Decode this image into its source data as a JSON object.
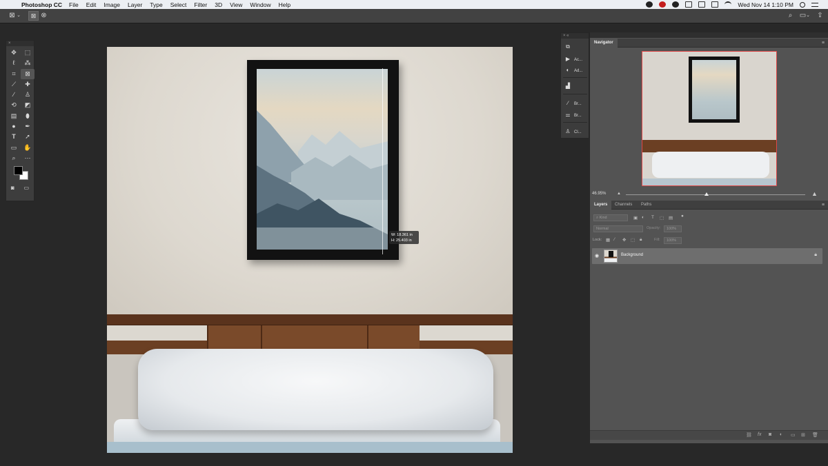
{
  "menubar": {
    "apple": "",
    "app_name": "Photoshop CC",
    "items": [
      "File",
      "Edit",
      "Image",
      "Layer",
      "Type",
      "Select",
      "Filter",
      "3D",
      "View",
      "Window",
      "Help"
    ],
    "datetime": "Wed Nov 14  1:10 PM"
  },
  "canvas": {
    "measure_w": "W:  18.361 in",
    "measure_h": "H:  25.403 in"
  },
  "panel_strip": {
    "items": [
      "Ac...",
      "Ad...",
      "Br...",
      "Br...",
      "Cl..."
    ]
  },
  "navigator": {
    "tab": "Navigator",
    "zoom": "46.95%"
  },
  "layers": {
    "tabs": [
      "Layers",
      "Channels",
      "Paths"
    ],
    "kind_placeholder": "Kind",
    "blend_mode": "Normal",
    "opacity_label": "Opacity:",
    "opacity_value": "100%",
    "lock_label": "Lock:",
    "fill_label": "Fill:",
    "fill_value": "100%",
    "layer_name": "Background"
  },
  "colors": {
    "accent_red": "#e04848",
    "panel_bg": "#535353",
    "app_bg": "#282828"
  }
}
